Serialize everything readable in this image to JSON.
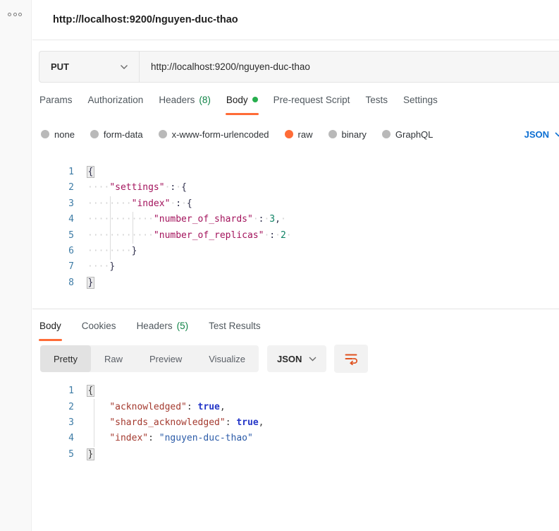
{
  "colors": {
    "accent": "#ff6c37",
    "count_green": "#0e8345",
    "dot_green": "#27ae4e",
    "link_blue": "#0d6fd2"
  },
  "icons": {
    "more_options": "three-dot circles",
    "chevron_down": "v",
    "wrap_text": "orange wrap-lines arrow"
  },
  "tab_header": {
    "title": "http://localhost:9200/nguyen-duc-thao"
  },
  "request": {
    "method": "PUT",
    "url": "http://localhost:9200/nguyen-duc-thao",
    "tabs": [
      {
        "label": "Params"
      },
      {
        "label": "Authorization"
      },
      {
        "label": "Headers",
        "count": "(8)"
      },
      {
        "label": "Body",
        "active": true,
        "has_dot": true
      },
      {
        "label": "Pre-request Script"
      },
      {
        "label": "Tests"
      },
      {
        "label": "Settings"
      }
    ],
    "body_types": [
      {
        "label": "none"
      },
      {
        "label": "form-data"
      },
      {
        "label": "x-www-form-urlencoded"
      },
      {
        "label": "raw",
        "selected": true
      },
      {
        "label": "binary"
      },
      {
        "label": "GraphQL"
      }
    ],
    "language": "JSON",
    "editor_lines": [
      {
        "num": "1",
        "segments": [
          [
            "hl",
            "{"
          ]
        ]
      },
      {
        "num": "2",
        "segments": [
          [
            "w",
            "····"
          ],
          [
            "k",
            "\"settings\""
          ],
          [
            "w",
            "·"
          ],
          [
            "p",
            ":"
          ],
          [
            "w",
            "·"
          ],
          [
            "p",
            "{"
          ]
        ]
      },
      {
        "num": "3",
        "segments": [
          [
            "w",
            "········"
          ],
          [
            "k",
            "\"index\""
          ],
          [
            "w",
            "·"
          ],
          [
            "p",
            ":"
          ],
          [
            "w",
            "·"
          ],
          [
            "p",
            "{"
          ]
        ]
      },
      {
        "num": "4",
        "segments": [
          [
            "w",
            "············"
          ],
          [
            "k",
            "\"number_of_shards\""
          ],
          [
            "w",
            "·"
          ],
          [
            "p",
            ":"
          ],
          [
            "w",
            "·"
          ],
          [
            "n",
            "3"
          ],
          [
            "p",
            ","
          ],
          [
            "w",
            "·"
          ]
        ]
      },
      {
        "num": "5",
        "segments": [
          [
            "w",
            "············"
          ],
          [
            "k",
            "\"number_of_replicas\""
          ],
          [
            "w",
            "·"
          ],
          [
            "p",
            ":"
          ],
          [
            "w",
            "·"
          ],
          [
            "n",
            "2"
          ],
          [
            "w",
            "·"
          ]
        ]
      },
      {
        "num": "6",
        "segments": [
          [
            "w",
            "········"
          ],
          [
            "p",
            "}"
          ]
        ]
      },
      {
        "num": "7",
        "segments": [
          [
            "w",
            "····"
          ],
          [
            "p",
            "}"
          ]
        ]
      },
      {
        "num": "8",
        "segments": [
          [
            "hl",
            "}"
          ]
        ]
      }
    ]
  },
  "response": {
    "tabs": [
      {
        "label": "Body",
        "active": true
      },
      {
        "label": "Cookies"
      },
      {
        "label": "Headers",
        "count": "(5)"
      },
      {
        "label": "Test Results"
      }
    ],
    "views": [
      {
        "label": "Pretty",
        "selected": true
      },
      {
        "label": "Raw"
      },
      {
        "label": "Preview"
      },
      {
        "label": "Visualize"
      }
    ],
    "format": "JSON",
    "editor_lines": [
      {
        "num": "1",
        "segments": [
          [
            "hl",
            "{"
          ]
        ]
      },
      {
        "num": "2",
        "segments": [
          [
            "t",
            "    "
          ],
          [
            "k",
            "\"acknowledged\""
          ],
          [
            "p",
            ":"
          ],
          [
            "t",
            " "
          ],
          [
            "b",
            "true"
          ],
          [
            "p",
            ","
          ]
        ]
      },
      {
        "num": "3",
        "segments": [
          [
            "t",
            "    "
          ],
          [
            "k",
            "\"shards_acknowledged\""
          ],
          [
            "p",
            ":"
          ],
          [
            "t",
            " "
          ],
          [
            "b",
            "true"
          ],
          [
            "p",
            ","
          ]
        ]
      },
      {
        "num": "4",
        "segments": [
          [
            "t",
            "    "
          ],
          [
            "k",
            "\"index\""
          ],
          [
            "p",
            ":"
          ],
          [
            "t",
            " "
          ],
          [
            "s",
            "\"nguyen-duc-thao\""
          ]
        ]
      },
      {
        "num": "5",
        "segments": [
          [
            "hl",
            "}"
          ]
        ]
      }
    ]
  }
}
